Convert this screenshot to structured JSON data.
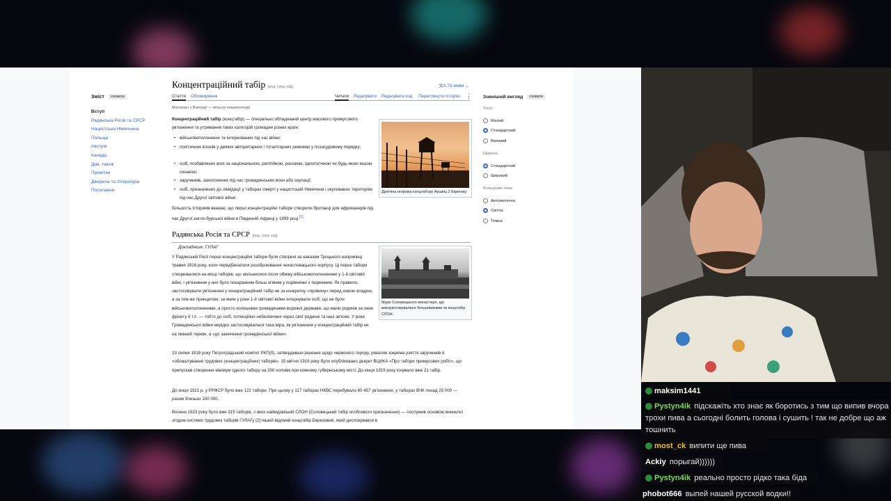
{
  "wiki": {
    "title": "Концентраційний табір",
    "title_edit": "[ред. | ред. код]",
    "languages": "文A  73 мови ⌄",
    "tabs": {
      "article": "Стаття",
      "discussion": "Обговорення",
      "read": "Читати",
      "edit": "Редагувати",
      "edit_code": "Редагувати код",
      "history": "Переглянути історію"
    },
    "from_wiki": "Матеріал з Вікіпедії — вільної енциклопедії",
    "toc": {
      "title": "Зміст",
      "hide": "сховати",
      "items": [
        "Вступ",
        "Радянська Росія та СРСР",
        "Нацистська Німеччина",
        "Польща",
        "Австрія",
        "Канада",
        "Див. також",
        "Примітки",
        "Джерела та література",
        "Посилання"
      ]
    },
    "intro": {
      "p1_bold": "Концентраційний табір",
      "p1_paren": " (концтабір)",
      "p1_rest": " — спеціально обладнаний центр масового примусового ув'язнення та утримання таких категорій громадян різних країн:",
      "bullets": [
        "військовополонених та інтернованих під час війни;",
        "політичних в'язнів у деяких авторитарних і тоталітарних режимах у позасудовому порядку;",
        "осіб, позбавлених волі за національною, релігійною, расовою, ідеологічною чи будь-якою іншою ознакою;",
        "заручників, захопленних під час громадянських воєн або окупації;",
        "осіб, призначених до ліквідації у таборах смерті у нацистській Німеччині і окупованих територіях під час Другої світової війни."
      ],
      "p2": "Більшість істориків вважає, що перші концентраційні табори створили британці для африканерів під час Другої англо-бурської війни в Південній Африці у 1899 році.",
      "p2_ref": "[1]"
    },
    "figure1_caption": "Дротяна огорожа концтабору Аушвіц 2 Біркенау",
    "section1": {
      "heading": "Радянська Росія та СРСР",
      "edit": "[ред. | ред. код]",
      "hatnote": "Докладніше: ГУЛАГ",
      "p1": "У Радянській Росії перші концентраційні табори були створені за наказом Троцького наприкінці травня 1918 року, коли передбачалося роззброювання чехословацького корпусу. Ці перші табори створювалися на місці таборів, що звільнилися після обміну військовополоненими у 1-й світовій війні, і ув'язнення у них було покаранням більш м'яким у порівнянні з тюремним. Як правило, застосовували ув'язнення у концентраційний табір не за конкретну «провину» перед новою владою, а за тим же принципом, за яким у роки 1-й світової війни інтернували осіб, що не були військовополоненими, а просто колишніми громадянами ворожої держави, що мали родичів за гнею фронту й т.п. — тобто до осіб, потенційно небезпечних через свої родинні та інші зв'язки. У роки Громадянської війни нерідко застосовувалася така міра, як ув'язнення у концентраційний табір не на певний термін, а «до закінчення громадянської війни».",
      "p2": "23 липня 1918 року Петроградський комітет РКП(б), затвердивши рішення щодо червоного терору, ухвалив зокрема узяття заручників й «облаштування трудових (концентраційних) таборів». 15 квітня 1919 року було опубліковано декрет ВЦИКА «Про табори примусових робіт», що припускав створення мінімум одного табору на 300 чоловік при кожному губернському місті. До кінця 1919 року існувало вже 21 табір.",
      "p3": "До кінця 1921 р. у РРФСР було вже 122 табори. При цьому у 117 таборах НКВС перебувало 60 457 ув'язнених, у таборах ВЧК понад 25 000 — разом близько 100 000.",
      "p4": "Восени 1923 року було вже 315 таборів, з яких найвідоміший СЛОН (Соловецький табір особливого призначення) — послужив основою виниклої згодом системи трудових таборів ГУЛАГу [2] Інший відомий концтабір Березовий, який дислокувався в"
    },
    "figure2_caption": "Мури Соловецького монастиря, що використовувалися більшовиками як концтабір СЛОН.",
    "appearance": {
      "title": "Зовнішній вигляд",
      "hide": "сховати",
      "text_label": "Текст",
      "text_options": [
        "Малий",
        "Стандартний",
        "Великий"
      ],
      "width_label": "Ширина",
      "width_options": [
        "Стандартний",
        "Широкий"
      ],
      "color_label": "Кольорова тема",
      "color_options": [
        "Автоматична",
        "Світла",
        "Темна"
      ]
    }
  },
  "chat": [
    {
      "user": "maksim1441",
      "text": "",
      "color": "#ffffff"
    },
    {
      "user": "Pystyn4ik",
      "text": "підскажіть хто знає як боротись з тим що випив вчора трохи пива а сьогодні болить голова і сушить ! так не добре що аж тошнить",
      "color": "#7cdc54"
    },
    {
      "user": "most_ck",
      "text": "випити ще пива",
      "color": "#f0c030"
    },
    {
      "user": "Ackiy",
      "text": "порыгай))))))",
      "color": "#ffffff"
    },
    {
      "user": "Pystyn4ik",
      "text": "реально просто рідко така біда",
      "color": "#7cdc54"
    },
    {
      "user": "phobot666",
      "text": "выпей нашей русской водки!!",
      "color": "#ffffff"
    }
  ],
  "colors": {
    "link": "#3366cc",
    "text": "#202122"
  }
}
